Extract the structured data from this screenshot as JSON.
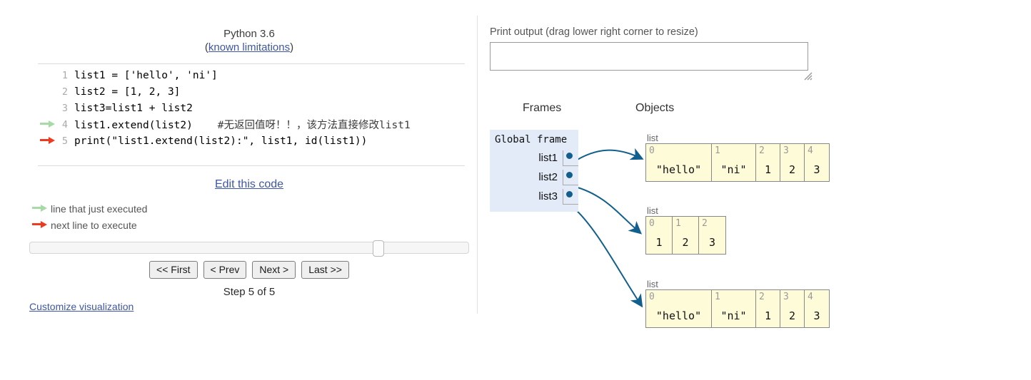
{
  "left": {
    "language_title": "Python 3.6",
    "known_limitations_prefix": "(",
    "known_limitations_label": "known limitations",
    "known_limitations_suffix": ")",
    "code_lines": [
      {
        "number": "1",
        "text": "list1 = ['hello', 'ni']",
        "arrow": "none"
      },
      {
        "number": "2",
        "text": "list2 = [1, 2, 3]",
        "arrow": "none"
      },
      {
        "number": "3",
        "text": "list3=list1 + list2",
        "arrow": "none"
      },
      {
        "number": "4",
        "text": "list1.extend(list2)",
        "comment": "#无返回值呀！！，该方法直接修改list1",
        "arrow": "green"
      },
      {
        "number": "5",
        "text": "print(\"list1.extend(list2):\", list1, id(list1))",
        "arrow": "red"
      }
    ],
    "edit_code_label": "Edit this code",
    "legend": [
      {
        "icon": "green-arrow-icon",
        "label": "line that just executed",
        "color": "#a6dba6"
      },
      {
        "icon": "red-arrow-icon",
        "label": "next line to execute",
        "color": "#ee3b20"
      }
    ],
    "slider": {
      "position_percent": 78,
      "min_step": 1,
      "max_step": 5,
      "current_step": 5
    },
    "nav_buttons": [
      {
        "label": "<< First",
        "name": "first-button"
      },
      {
        "label": "< Prev",
        "name": "prev-button"
      },
      {
        "label": "Next >",
        "name": "next-button"
      },
      {
        "label": "Last >>",
        "name": "last-button"
      }
    ],
    "step_label": "Step 5 of 5",
    "customize_label": "Customize visualization"
  },
  "right": {
    "print_output_label": "Print output (drag lower right corner to resize)",
    "print_output_value": "",
    "frames_heading": "Frames",
    "objects_heading": "Objects",
    "global_frame": {
      "title": "Global frame",
      "variables": [
        {
          "name": "list1",
          "points_to": 0
        },
        {
          "name": "list2",
          "points_to": 1
        },
        {
          "name": "list3",
          "points_to": 2
        }
      ]
    },
    "objects": [
      {
        "type_label": "list",
        "cells": [
          {
            "index": "0",
            "value": "\"hello\"",
            "width": 92
          },
          {
            "index": "1",
            "value": "\"ni\"",
            "width": 62
          },
          {
            "index": "2",
            "value": "1",
            "width": 34
          },
          {
            "index": "3",
            "value": "2",
            "width": 34
          },
          {
            "index": "4",
            "value": "3",
            "width": 34
          }
        ]
      },
      {
        "type_label": "list",
        "cells": [
          {
            "index": "0",
            "value": "1",
            "width": 37
          },
          {
            "index": "1",
            "value": "2",
            "width": 37
          },
          {
            "index": "2",
            "value": "3",
            "width": 37
          }
        ]
      },
      {
        "type_label": "list",
        "cells": [
          {
            "index": "0",
            "value": "\"hello\"",
            "width": 92
          },
          {
            "index": "1",
            "value": "\"ni\"",
            "width": 62
          },
          {
            "index": "2",
            "value": "1",
            "width": 34
          },
          {
            "index": "3",
            "value": "2",
            "width": 34
          },
          {
            "index": "4",
            "value": "3",
            "width": 34
          }
        ]
      }
    ]
  },
  "colors": {
    "frame_bg": "#e2ebf7",
    "object_bg": "#fdfbd8",
    "object_border": "#888888",
    "pointer": "#135e8c",
    "link": "#3d56a8",
    "arrow_green": "#a6dba6",
    "arrow_red": "#ee3b20"
  }
}
